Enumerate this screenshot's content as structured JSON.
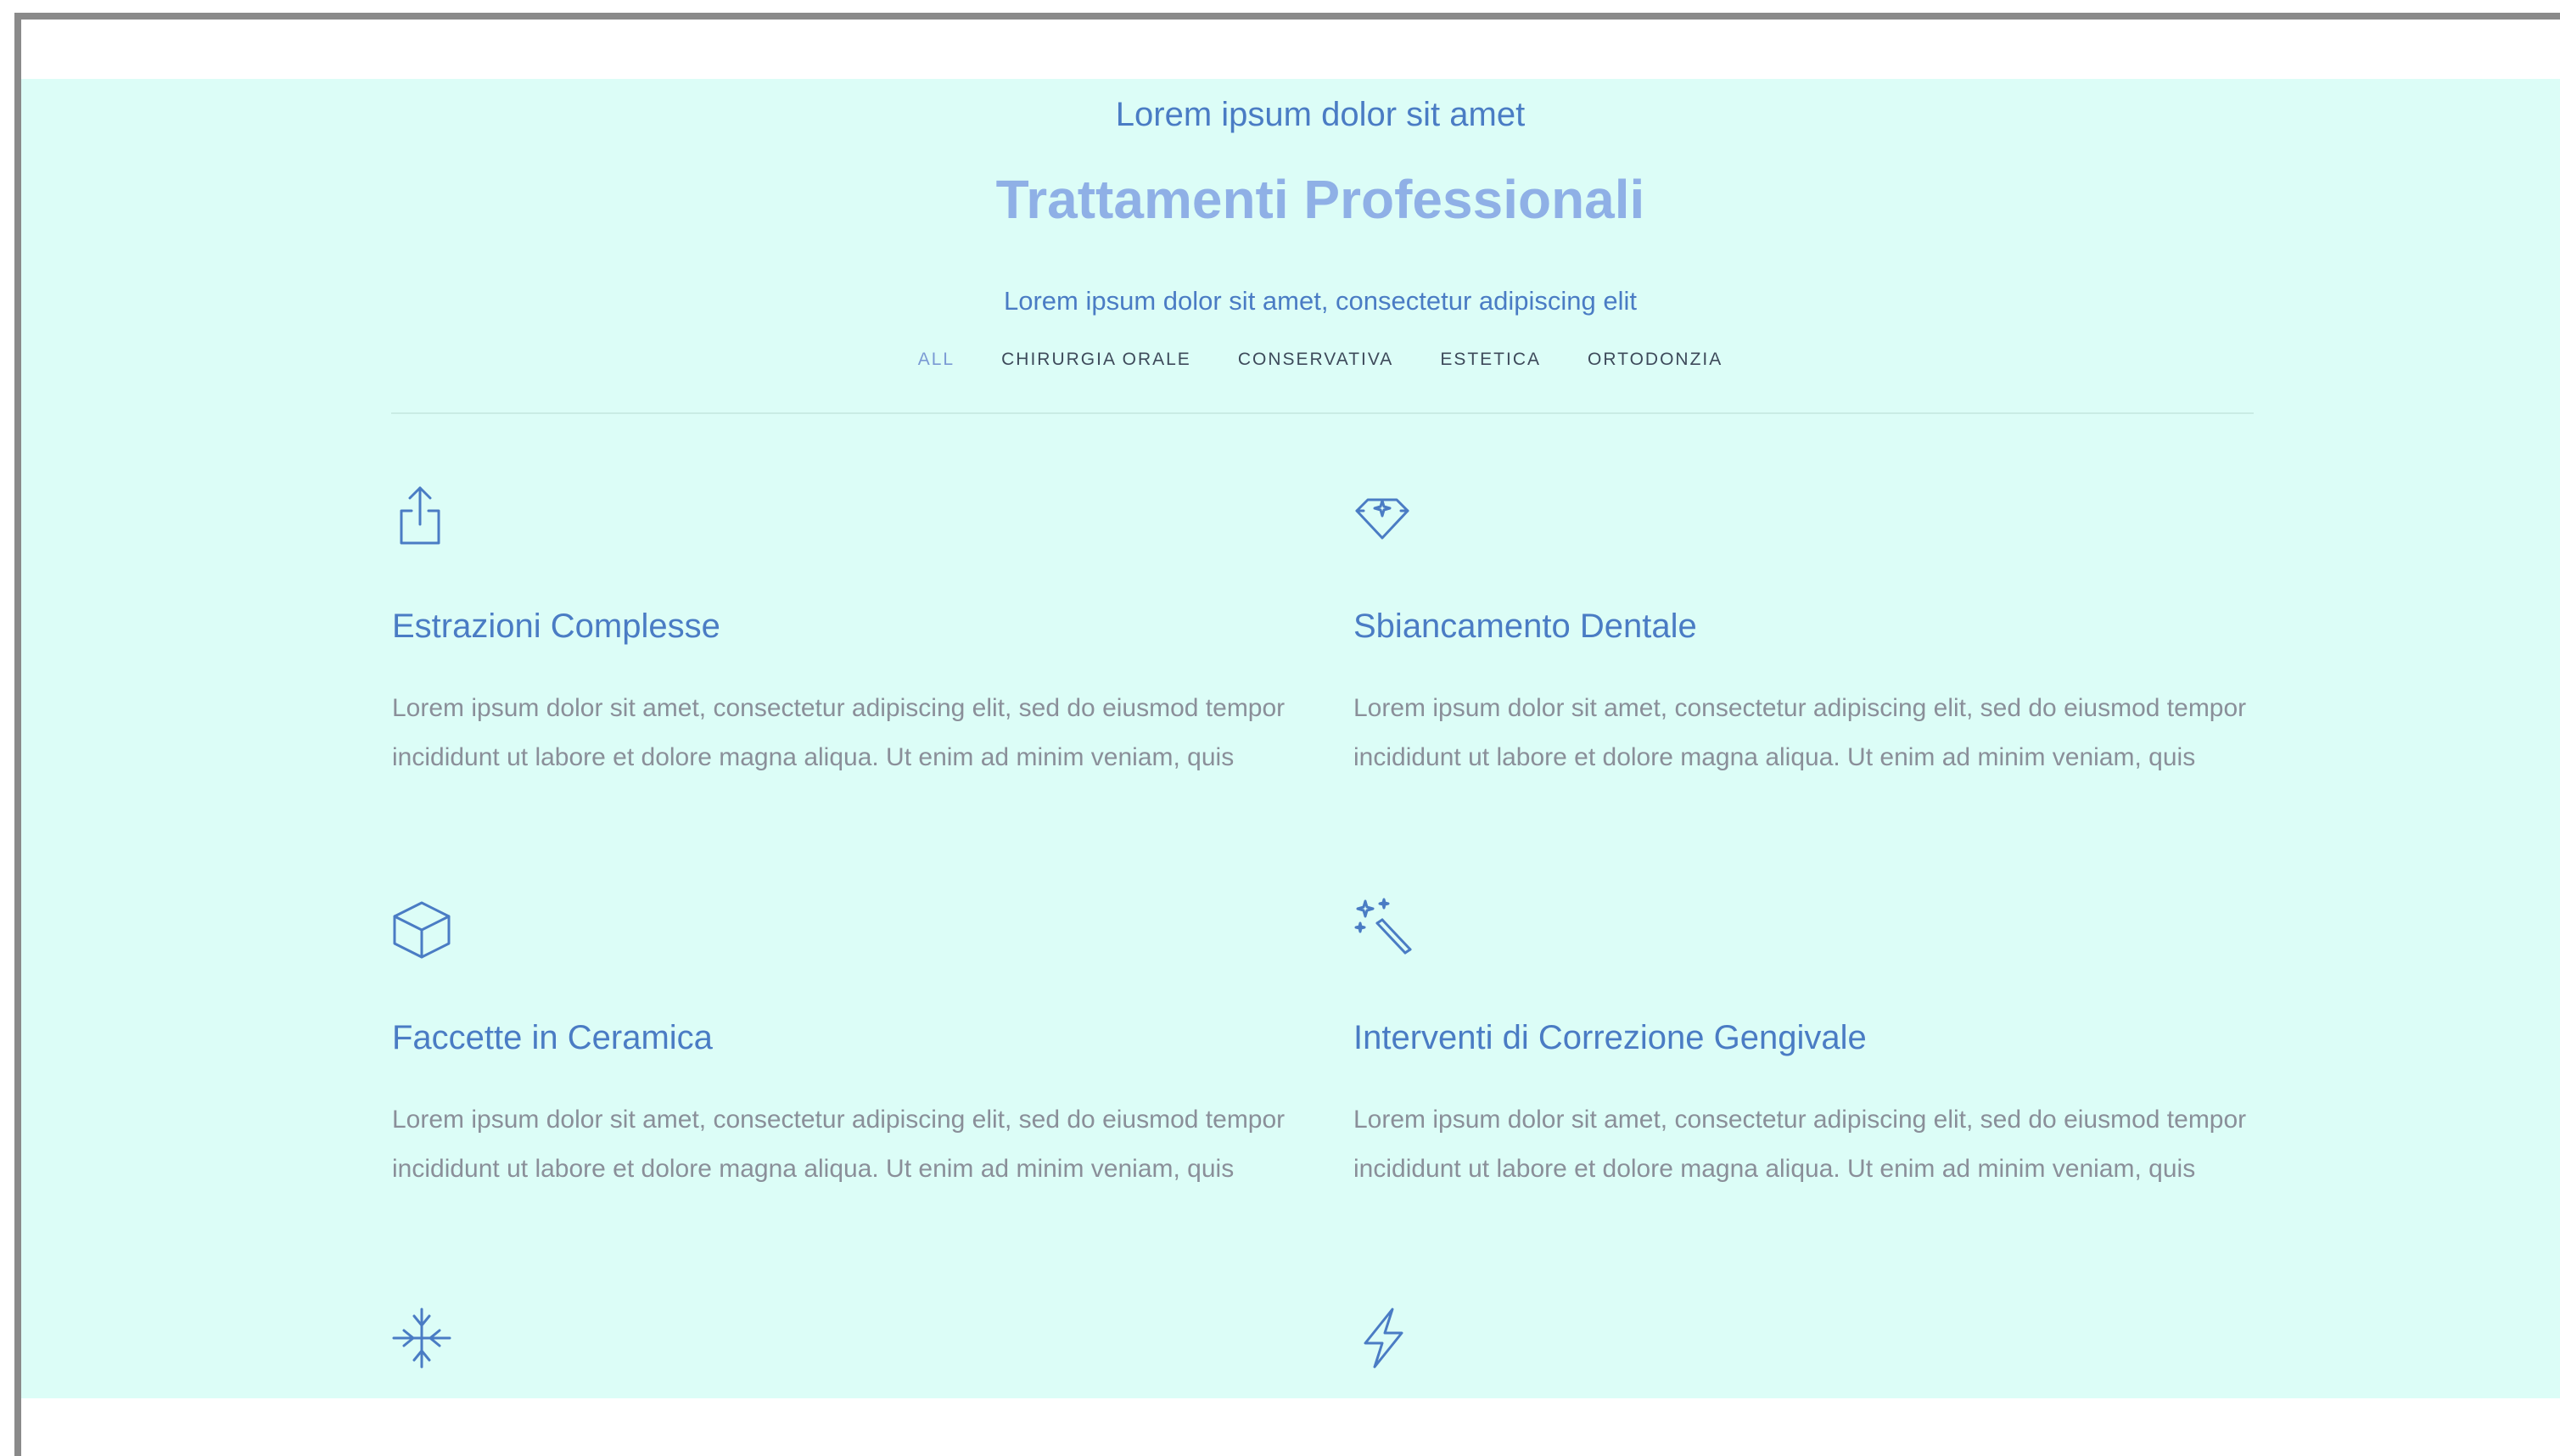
{
  "header": {
    "eyebrow": "Lorem ipsum dolor sit amet",
    "title": "Trattamenti Professionali",
    "subtitle": "Lorem ipsum dolor sit amet, consectetur adipiscing elit"
  },
  "filters": [
    "ALL",
    "CHIRURGIA ORALE",
    "CONSERVATIVA",
    "ESTETICA",
    "ORTODONZIA"
  ],
  "active_filter": "ALL",
  "services": [
    {
      "icon": "share-export-icon",
      "title": "Estrazioni Complesse",
      "text": "Lorem ipsum dolor sit amet, consectetur adipiscing elit, sed do eiusmod tempor incididunt ut labore et dolore magna aliqua. Ut enim ad minim veniam, quis"
    },
    {
      "icon": "diamond-sparkle-icon",
      "title": "Sbiancamento Dentale",
      "text": "Lorem ipsum dolor sit amet, consectetur adipiscing elit, sed do eiusmod tempor incididunt ut labore et dolore magna aliqua. Ut enim ad minim veniam, quis"
    },
    {
      "icon": "cube-icon",
      "title": "Faccette in Ceramica",
      "text": "Lorem ipsum dolor sit amet, consectetur adipiscing elit, sed do eiusmod tempor incididunt ut labore et dolore magna aliqua. Ut enim ad minim veniam, quis"
    },
    {
      "icon": "magic-wand-icon",
      "title": "Interventi di Correzione Gengivale",
      "text": "Lorem ipsum dolor sit amet, consectetur adipiscing elit, sed do eiusmod tempor incididunt ut labore et dolore magna aliqua. Ut enim ad minim veniam, quis"
    },
    {
      "icon": "arrows-in-icon"
    },
    {
      "icon": "lightning-icon"
    }
  ],
  "colors": {
    "background": "#dcfdf7",
    "accent": "#4a7cc4",
    "title": "#8fb0e6",
    "body_text": "#8a8f99",
    "frame": "#8a8a8a"
  }
}
